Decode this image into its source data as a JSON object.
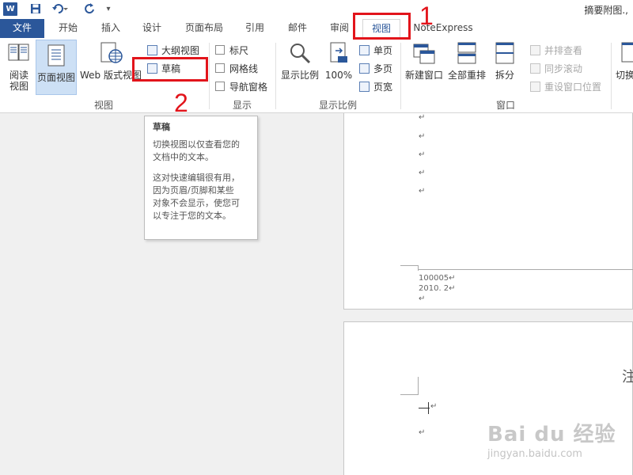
{
  "titlebar": {
    "app_icon_letter": "W",
    "undo_icon": "undo-icon",
    "redo_icon": "redo-icon",
    "doc_title": "摘要附图.,"
  },
  "tabs": {
    "file": "文件",
    "items": [
      "开始",
      "插入",
      "设计",
      "页面布局",
      "引用",
      "邮件",
      "审阅",
      "视图",
      "NoteExpress"
    ]
  },
  "ribbon": {
    "view_group": {
      "label": "视图",
      "read": [
        "阅读",
        "视图"
      ],
      "print_layout": "页面视图",
      "web_layout": "Web 版式视图",
      "outline": "大纲视图",
      "draft": "草稿"
    },
    "show_group": {
      "label": "显示",
      "ruler": "标尺",
      "gridlines": "网格线",
      "nav_pane": "导航窗格"
    },
    "zoom_group": {
      "label": "显示比例",
      "zoom": "显示比例",
      "zoom100": "100%",
      "one_page": "单页",
      "multi_page": "多页",
      "page_width": "页宽"
    },
    "window_group": {
      "label": "窗口",
      "new_window": "新建窗口",
      "arrange_all": "全部重排",
      "split": "拆分",
      "side_by_side": "并排查看",
      "sync_scroll": "同步滚动",
      "reset_pos": "重设窗口位置",
      "switch": "切换"
    }
  },
  "tooltip": {
    "title": "草稿",
    "p1": [
      "切换视图以仅查看您的",
      "文档中的文本。"
    ],
    "p2": [
      "这对快速编辑很有用，",
      "因为页眉/页脚和某些",
      "对象不会显示，使您可",
      "以专注于您的文本。"
    ]
  },
  "document": {
    "para_mark": "↵",
    "line1": "100005↵",
    "line2": "2010. 2↵",
    "page2_char": "注"
  },
  "annotations": {
    "n1": "1",
    "n2": "2",
    "color": "#e2141b"
  },
  "watermark": {
    "logo": "Bai du 经验",
    "url": "jingyan.baidu.com"
  }
}
